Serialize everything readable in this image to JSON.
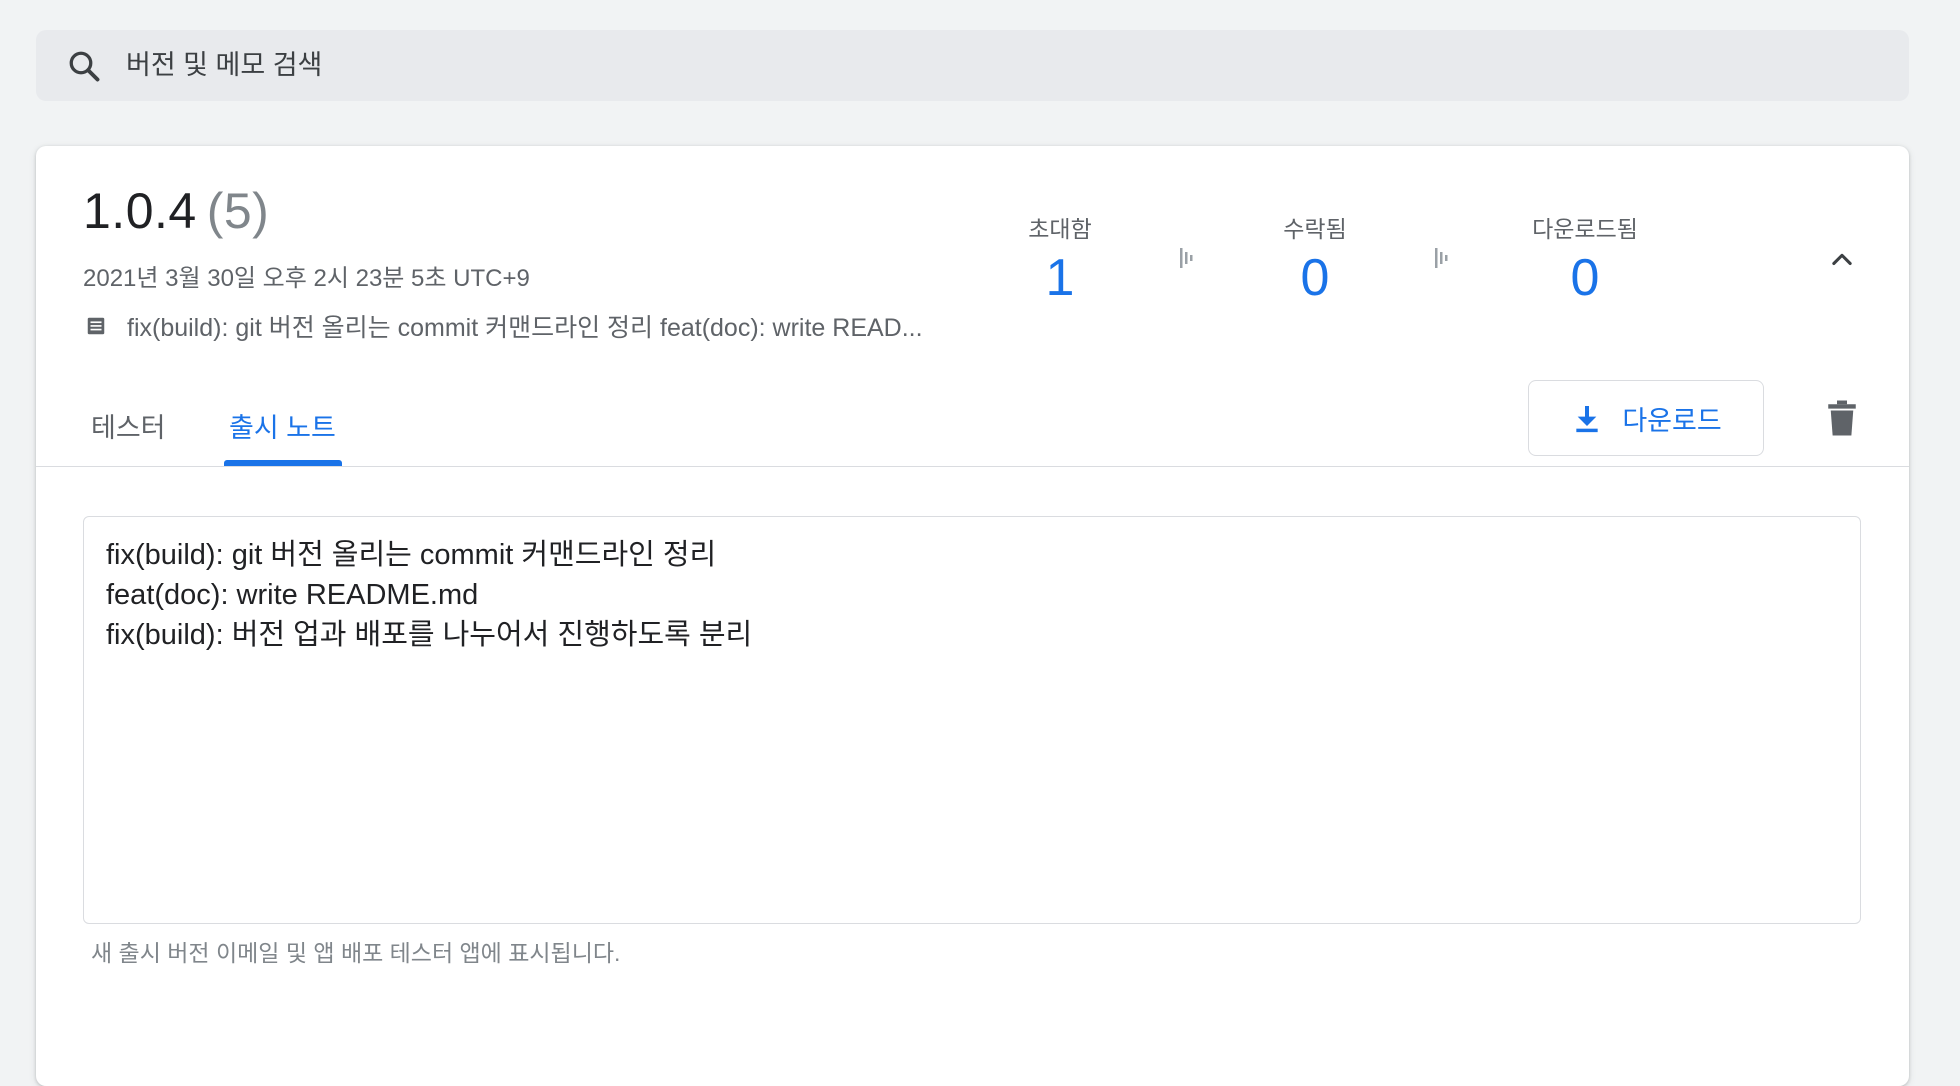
{
  "search": {
    "placeholder": "버전 및 메모 검색",
    "icon": "search-icon"
  },
  "release": {
    "version": "1.0.4",
    "build": "(5)",
    "date": "2021년 3월 30일 오후 2시 23분 5초 UTC+9",
    "notes_summary": "fix(build): git 버전 올리는 commit 커맨드라인 정리 feat(doc): write READ...",
    "stats": {
      "invited_label": "초대함",
      "invited_value": "1",
      "accepted_label": "수락됨",
      "accepted_value": "0",
      "downloaded_label": "다운로드됨",
      "downloaded_value": "0"
    }
  },
  "tabs": [
    {
      "label": "테스터",
      "active": false
    },
    {
      "label": "출시 노트",
      "active": true
    }
  ],
  "actions": {
    "download_label": "다운로드",
    "delete_icon": "trash-icon",
    "collapse_icon": "chevron-up-icon"
  },
  "notes": {
    "value": "fix(build): git 버전 올리는 commit 커맨드라인 정리\nfeat(doc): write README.md\nfix(build): 버전 업과 배포를 나누어서 진행하도록 분리",
    "helper": "새 출시 버전 이메일 및 앱 배포 테스터 앱에 표시됩니다."
  },
  "colors": {
    "accent": "#1a73e8",
    "background": "#f1f3f4",
    "muted_text": "#5f6368"
  }
}
